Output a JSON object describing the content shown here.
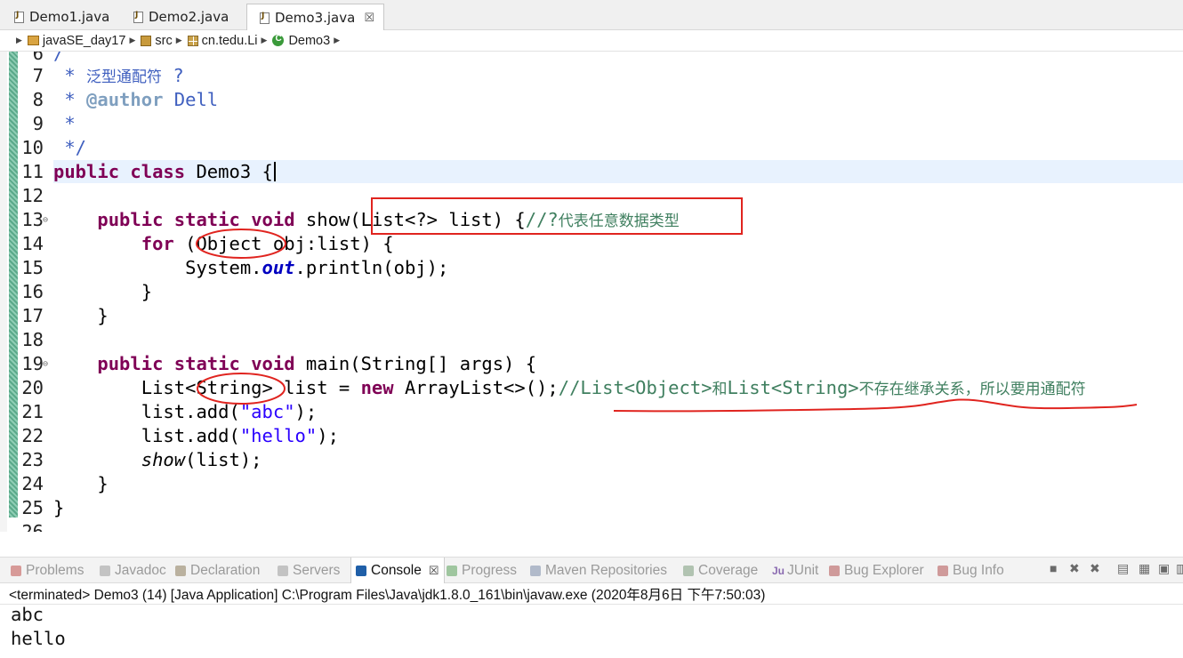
{
  "editor_tabs": [
    {
      "label": "Demo1.java",
      "active": false
    },
    {
      "label": "Demo2.java",
      "active": false
    },
    {
      "label": "Demo3.java",
      "active": true,
      "close": "☒"
    }
  ],
  "breadcrumb": [
    "javaSE_day17",
    "src",
    "cn.tedu.Li",
    "Demo3"
  ],
  "code": {
    "partial_top_line": "6  /",
    "partial_bottom_line": "26",
    "lines": [
      {
        "n": "7",
        "tokens": [
          [
            " * ",
            "jd"
          ],
          [
            "泛型通配符 ?",
            "jd"
          ]
        ]
      },
      {
        "n": "8",
        "tokens": [
          [
            " * ",
            "jd"
          ],
          [
            "@author",
            "tag"
          ],
          [
            " Dell",
            "jd"
          ]
        ]
      },
      {
        "n": "9",
        "tokens": [
          [
            " *",
            "jd"
          ]
        ]
      },
      {
        "n": "10",
        "tokens": [
          [
            " */",
            "jd"
          ]
        ]
      },
      {
        "n": "11",
        "tokens": [
          [
            "public",
            "kw"
          ],
          [
            " ",
            ""
          ],
          [
            "class",
            "kw"
          ],
          [
            " Demo3 {",
            ""
          ]
        ]
      },
      {
        "n": "12",
        "tokens": []
      },
      {
        "n": "13",
        "fold": true,
        "tokens": [
          [
            "    ",
            ""
          ],
          [
            "public",
            "kw"
          ],
          [
            " ",
            ""
          ],
          [
            "static",
            "kw"
          ],
          [
            " ",
            ""
          ],
          [
            "void",
            "kw"
          ],
          [
            " show(List<?> list) {",
            ""
          ],
          [
            "//?代表任意数据类型",
            "cm"
          ]
        ]
      },
      {
        "n": "14",
        "tokens": [
          [
            "        ",
            ""
          ],
          [
            "for",
            "kw"
          ],
          [
            " (Object obj:list) {",
            ""
          ]
        ]
      },
      {
        "n": "15",
        "tokens": [
          [
            "            System.",
            ""
          ],
          [
            "out",
            "fi"
          ],
          [
            ".println(obj);",
            ""
          ]
        ]
      },
      {
        "n": "16",
        "tokens": [
          [
            "        }",
            ""
          ]
        ]
      },
      {
        "n": "17",
        "tokens": [
          [
            "    }",
            ""
          ]
        ]
      },
      {
        "n": "18",
        "tokens": []
      },
      {
        "n": "19",
        "fold": true,
        "tokens": [
          [
            "    ",
            ""
          ],
          [
            "public",
            "kw"
          ],
          [
            " ",
            ""
          ],
          [
            "static",
            "kw"
          ],
          [
            " ",
            ""
          ],
          [
            "void",
            "kw"
          ],
          [
            " main(String[] args) {",
            ""
          ]
        ]
      },
      {
        "n": "20",
        "tokens": [
          [
            "        List<String> list = ",
            ""
          ],
          [
            "new",
            "kw"
          ],
          [
            " ArrayList<>();",
            ""
          ],
          [
            "//List<Object>和List<String>不存在继承关系，所以要用通配符",
            "cm"
          ]
        ]
      },
      {
        "n": "21",
        "tokens": [
          [
            "        list.add(",
            ""
          ],
          [
            "\"abc\"",
            "st"
          ],
          [
            ");",
            ""
          ]
        ]
      },
      {
        "n": "22",
        "tokens": [
          [
            "        list.add(",
            ""
          ],
          [
            "\"hello\"",
            "st"
          ],
          [
            ");",
            ""
          ]
        ]
      },
      {
        "n": "23",
        "tokens": [
          [
            "        ",
            ""
          ],
          [
            "show",
            "it"
          ],
          [
            "(list);",
            ""
          ]
        ]
      },
      {
        "n": "24",
        "tokens": [
          [
            "    }",
            ""
          ]
        ]
      },
      {
        "n": "25",
        "tokens": [
          [
            "}",
            ""
          ]
        ]
      }
    ]
  },
  "views_tabs": [
    {
      "label": "Problems",
      "icon": "problems-icon",
      "color": "#c0504d"
    },
    {
      "label": "Javadoc",
      "icon": "javadoc-icon",
      "color": "#9a9a9a"
    },
    {
      "label": "Declaration",
      "icon": "declaration-icon",
      "color": "#8a7a5a"
    },
    {
      "label": "Servers",
      "icon": "servers-icon",
      "color": "#9a9a9a"
    },
    {
      "label": "Console",
      "icon": "console-icon",
      "color": "#1f5fa8",
      "active": true,
      "close": "☒"
    },
    {
      "label": "Progress",
      "icon": "progress-icon",
      "color": "#5aa05a"
    },
    {
      "label": "Maven Repositories",
      "icon": "maven-icon",
      "color": "#7a8aa8"
    },
    {
      "label": "Coverage",
      "icon": "coverage-icon",
      "color": "#7a9a7a"
    },
    {
      "label": "JUnit",
      "icon": "junit-icon",
      "color": "#8a6ab0",
      "prefix": "Ju"
    },
    {
      "label": "Bug Explorer",
      "icon": "bug-icon",
      "color": "#b05050"
    },
    {
      "label": "Bug Info",
      "icon": "bug-info-icon",
      "color": "#b05050"
    }
  ],
  "console": {
    "status": "<terminated> Demo3 (14) [Java Application] C:\\Program Files\\Java\\jdk1.8.0_161\\bin\\javaw.exe (2020年8月6日 下午7:50:03)",
    "output": [
      "abc",
      "hello"
    ]
  },
  "colors": {
    "keyword": "#7f0055",
    "comment": "#3f7f5f",
    "javadoc": "#3f5fbf",
    "string": "#2a00ff",
    "annotation_red": "#e0241f"
  }
}
